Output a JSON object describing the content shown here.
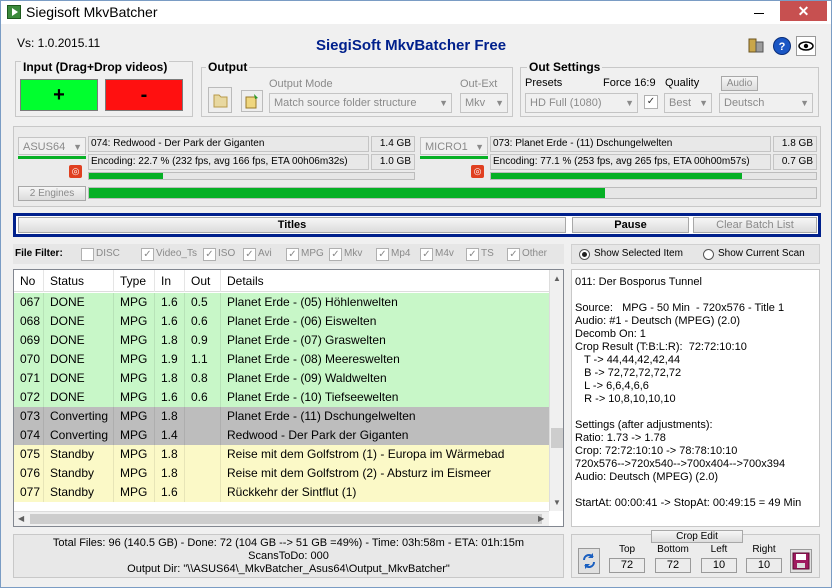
{
  "window": {
    "title": "Siegisoft MkvBatcher",
    "close": "✕"
  },
  "header": {
    "version": "Vs: 1.0.2015.11",
    "app_name": "SiegiSoft MkvBatcher Free"
  },
  "input": {
    "title": "Input (Drag+Drop videos)",
    "add_label": "+",
    "remove_label": "-"
  },
  "output": {
    "title": "Output",
    "mode_label": "Output Mode",
    "mode_value": "Match source folder structure",
    "ext_label": "Out-Ext",
    "ext_value": "Mkv"
  },
  "out_settings": {
    "title": "Out Settings",
    "presets_label": "Presets",
    "presets_value": "HD Full (1080)",
    "force_label": "Force 16:9",
    "quality_label": "Quality",
    "quality_value": "Best",
    "audio_label": "Audio",
    "audio_value": "Deutsch"
  },
  "engines": {
    "count_label": "2 Engines",
    "overall_progress": 0.71,
    "items": [
      {
        "name": "ASUS64",
        "file": "074: Redwood - Der Park der Giganten",
        "size_in": "1.4 GB",
        "status": "Encoding:  22.7 % (232 fps, avg 166 fps, ETA 00h06m32s)",
        "size_out": "1.0 GB",
        "progress": 0.227
      },
      {
        "name": "MICRO1",
        "file": "073: Planet Erde - (11) Dschungelwelten",
        "size_in": "1.8 GB",
        "status": "Encoding:  77.1 % (253 fps, avg 265 fps, ETA 00h00m57s)",
        "size_out": "0.7 GB",
        "progress": 0.771
      }
    ]
  },
  "actions": {
    "titles": "Titles",
    "pause": "Pause",
    "clear": "Clear Batch List"
  },
  "filter": {
    "label": "File Filter:",
    "items": [
      {
        "label": "DISC",
        "checked": false
      },
      {
        "label": "Video_Ts",
        "checked": true
      },
      {
        "label": "ISO",
        "checked": true
      },
      {
        "label": "Avi",
        "checked": true
      },
      {
        "label": "MPG",
        "checked": true
      },
      {
        "label": "Mkv",
        "checked": true
      },
      {
        "label": "Mp4",
        "checked": true
      },
      {
        "label": "M4v",
        "checked": true
      },
      {
        "label": "TS",
        "checked": true
      },
      {
        "label": "Other",
        "checked": true
      }
    ],
    "show_selected": "Show Selected Item",
    "show_current": "Show Current Scan"
  },
  "table": {
    "columns": [
      "No",
      "Status",
      "Type",
      "In",
      "Out",
      "Details"
    ],
    "rows": [
      {
        "no": "067",
        "status": "DONE",
        "type": "MPG",
        "in": "1.6",
        "out": "0.5",
        "details": "Planet Erde - (05) Höhlenwelten",
        "state": "done"
      },
      {
        "no": "068",
        "status": "DONE",
        "type": "MPG",
        "in": "1.6",
        "out": "0.6",
        "details": "Planet Erde - (06) Eiswelten",
        "state": "done"
      },
      {
        "no": "069",
        "status": "DONE",
        "type": "MPG",
        "in": "1.8",
        "out": "0.9",
        "details": "Planet Erde - (07) Graswelten",
        "state": "done"
      },
      {
        "no": "070",
        "status": "DONE",
        "type": "MPG",
        "in": "1.9",
        "out": "1.1",
        "details": "Planet Erde - (08) Meereswelten",
        "state": "done"
      },
      {
        "no": "071",
        "status": "DONE",
        "type": "MPG",
        "in": "1.8",
        "out": "0.8",
        "details": "Planet Erde - (09) Waldwelten",
        "state": "done"
      },
      {
        "no": "072",
        "status": "DONE",
        "type": "MPG",
        "in": "1.6",
        "out": "0.6",
        "details": "Planet Erde - (10) Tiefseewelten",
        "state": "done"
      },
      {
        "no": "073",
        "status": "Converting",
        "type": "MPG",
        "in": "1.8",
        "out": "",
        "details": "Planet Erde - (11) Dschungelwelten",
        "state": "conv"
      },
      {
        "no": "074",
        "status": "Converting",
        "type": "MPG",
        "in": "1.4",
        "out": "",
        "details": "Redwood - Der Park der Giganten",
        "state": "conv"
      },
      {
        "no": "075",
        "status": "Standby",
        "type": "MPG",
        "in": "1.8",
        "out": "",
        "details": "Reise mit dem Golfstrom (1) - Europa im Wärmebad",
        "state": "stby"
      },
      {
        "no": "076",
        "status": "Standby",
        "type": "MPG",
        "in": "1.8",
        "out": "",
        "details": "Reise mit dem Golfstrom (2) - Absturz im Eismeer",
        "state": "stby"
      },
      {
        "no": "077",
        "status": "Standby",
        "type": "MPG",
        "in": "1.6",
        "out": "",
        "details": "Rückkehr der Sintflut (1)",
        "state": "stby"
      }
    ]
  },
  "details": {
    "lines": [
      "011: Der Bosporus Tunnel",
      "",
      "Source:   MPG - 50 Min  - 720x576 - Title 1",
      "Audio: #1 - Deutsch (MPEG) (2.0)",
      "Decomb On: 1",
      "Crop Result (T:B:L:R):  72:72:10:10",
      "   T -> 44,44,42,42,44",
      "   B -> 72,72,72,72,72",
      "   L -> 6,6,4,6,6",
      "   R -> 10,8,10,10,10",
      "",
      "Settings (after adjustments):",
      "Ratio: 1.73 -> 1.78",
      "Crop: 72:72:10:10 -> 78:78:10:10",
      "720x576-->720x540-->700x404-->700x394",
      "Audio: Deutsch (MPEG) (2.0)",
      "",
      "StartAt: 00:00:41 -> StopAt: 00:49:15 = 49 Min"
    ]
  },
  "status": {
    "line1": "Total Files: 96  (140.5 GB) - Done: 72  (104 GB --> 51 GB =49%) - Time: 03h:58m - ETA: 01h:15m",
    "line2": "ScansToDo: 000",
    "line3": "Output Dir: \"\\\\ASUS64\\_MkvBatcher_Asus64\\Output_MkvBatcher\""
  },
  "crop": {
    "title": "Crop Edit",
    "top_label": "Top",
    "bottom_label": "Bottom",
    "left_label": "Left",
    "right_label": "Right",
    "top": "72",
    "bottom": "72",
    "left": "10",
    "right": "10"
  },
  "colors": {
    "add": "#00ff2e",
    "remove": "#ff1010",
    "progress": "#06b025",
    "title_blue": "#00208c",
    "done_row": "#c8f7c8",
    "converting_row": "#bdbdbd",
    "standby_row": "#fbf9c7"
  }
}
